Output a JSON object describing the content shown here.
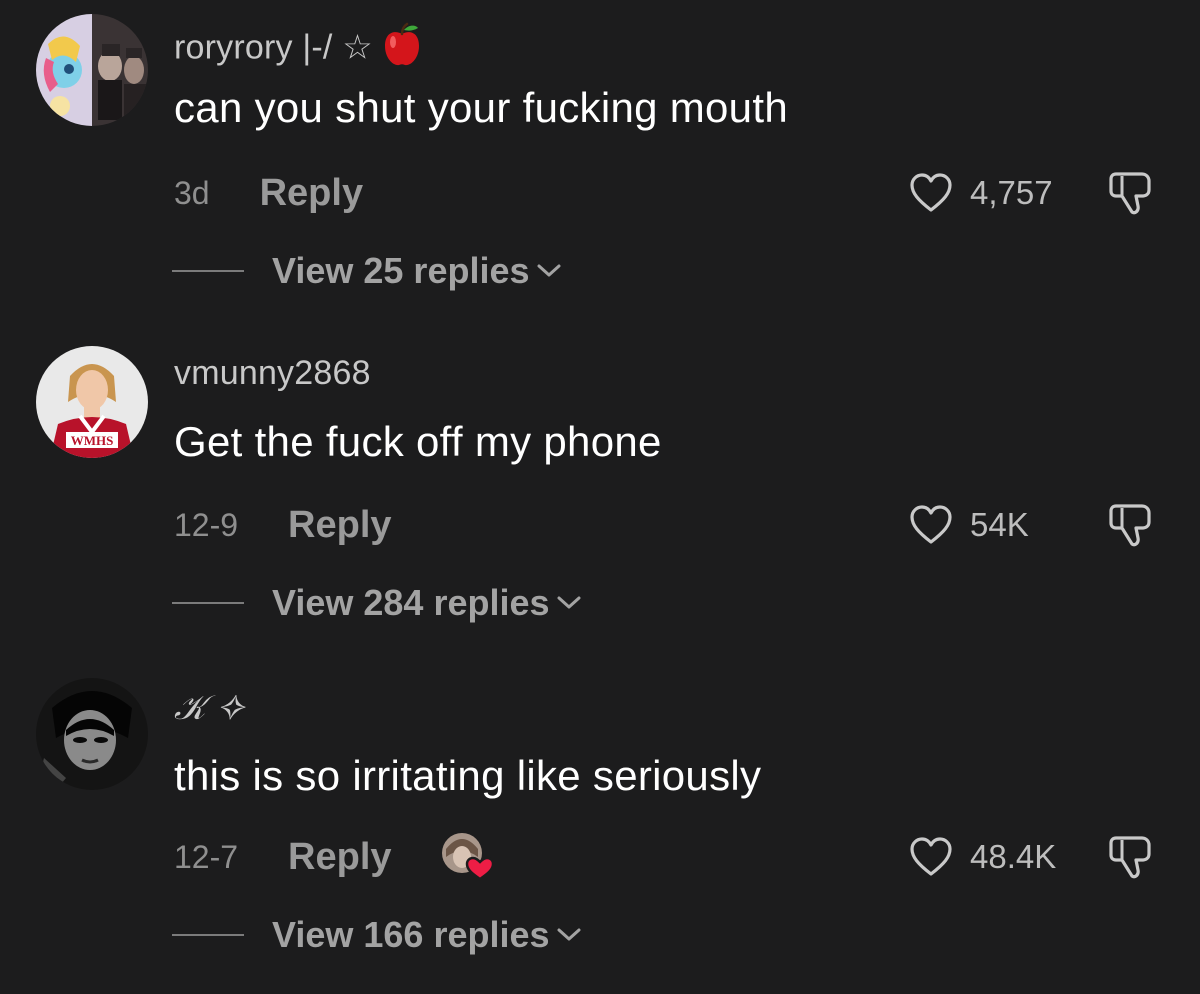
{
  "comments": [
    {
      "username": "roryrory |-/ ☆",
      "text": "can you shut your fucking mouth",
      "time": "3d",
      "reply_label": "Reply",
      "likes": "4,757",
      "view_replies": "View 25 replies",
      "avatar_icon": "avatar-collage",
      "badge_icon": "apple-emoji-icon"
    },
    {
      "username": "vmunny2868",
      "text": "Get the fuck off my phone",
      "time": "12-9",
      "reply_label": "Reply",
      "likes": "54K",
      "view_replies": "View 284 replies",
      "avatar_icon": "avatar-cheerleader",
      "avatar_logo": "WMHS"
    },
    {
      "username": "𝒦 ✧",
      "text": "this is so irritating like seriously",
      "time": "12-7",
      "reply_label": "Reply",
      "likes": "48.4K",
      "view_replies": "View 166 replies",
      "avatar_icon": "avatar-dark-character",
      "creator_liked_icon": "creator-liked-heart-icon"
    }
  ],
  "colors": {
    "background": "#1c1c1d",
    "text_primary": "#ffffff",
    "text_secondary": "#9a9a9a",
    "apple_red": "#d4151b",
    "heart_red": "#ee1d45"
  }
}
